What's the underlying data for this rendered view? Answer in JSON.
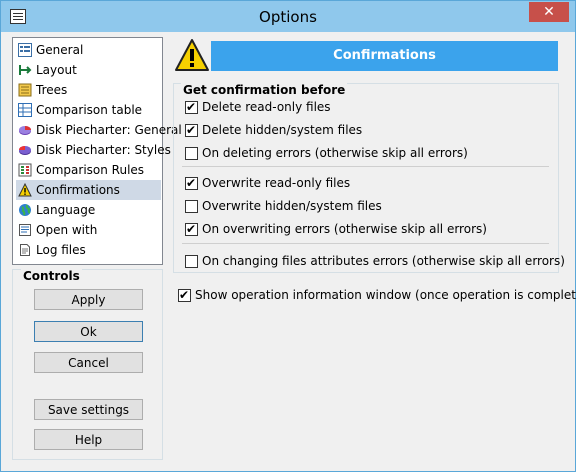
{
  "window": {
    "title": "Options",
    "close_label": "✕"
  },
  "nav": {
    "items": [
      {
        "label": "General",
        "icon": "general-icon"
      },
      {
        "label": "Layout",
        "icon": "layout-icon"
      },
      {
        "label": "Trees",
        "icon": "trees-icon"
      },
      {
        "label": "Comparison table",
        "icon": "comparison-table-icon"
      },
      {
        "label": "Disk Piecharter: General",
        "icon": "disk-piecharter-icon"
      },
      {
        "label": "Disk Piecharter: Styles",
        "icon": "disk-piecharter-styles-icon"
      },
      {
        "label": "Comparison Rules",
        "icon": "comparison-rules-icon"
      },
      {
        "label": "Confirmations",
        "icon": "warning-icon",
        "selected": true
      },
      {
        "label": "Language",
        "icon": "globe-icon"
      },
      {
        "label": "Open with",
        "icon": "open-with-icon"
      },
      {
        "label": "Log files",
        "icon": "log-files-icon"
      }
    ]
  },
  "controls": {
    "title": "Controls",
    "apply": "Apply",
    "ok": "Ok",
    "cancel": "Cancel",
    "save_settings": "Save settings",
    "help": "Help"
  },
  "panel": {
    "header": "Confirmations",
    "group_title": "Get confirmation before",
    "options": [
      {
        "label": "Delete read-only files",
        "checked": true
      },
      {
        "label": "Delete hidden/system files",
        "checked": true
      },
      {
        "label": "On deleting errors (otherwise skip all errors)",
        "checked": false
      },
      {
        "label": "Overwrite read-only files",
        "checked": true
      },
      {
        "label": "Overwrite hidden/system files",
        "checked": false
      },
      {
        "label": "On overwriting errors (otherwise skip all errors)",
        "checked": true
      },
      {
        "label": "On changing files attributes errors (otherwise skip all errors)",
        "checked": false
      }
    ],
    "show_info": {
      "label": "Show operation information window (once operation is completed)",
      "checked": true
    }
  },
  "colors": {
    "titlebar": "#8fc8ec",
    "header_bar": "#3ba3ec",
    "close": "#c7504a",
    "selected": "#cfd9e6"
  }
}
